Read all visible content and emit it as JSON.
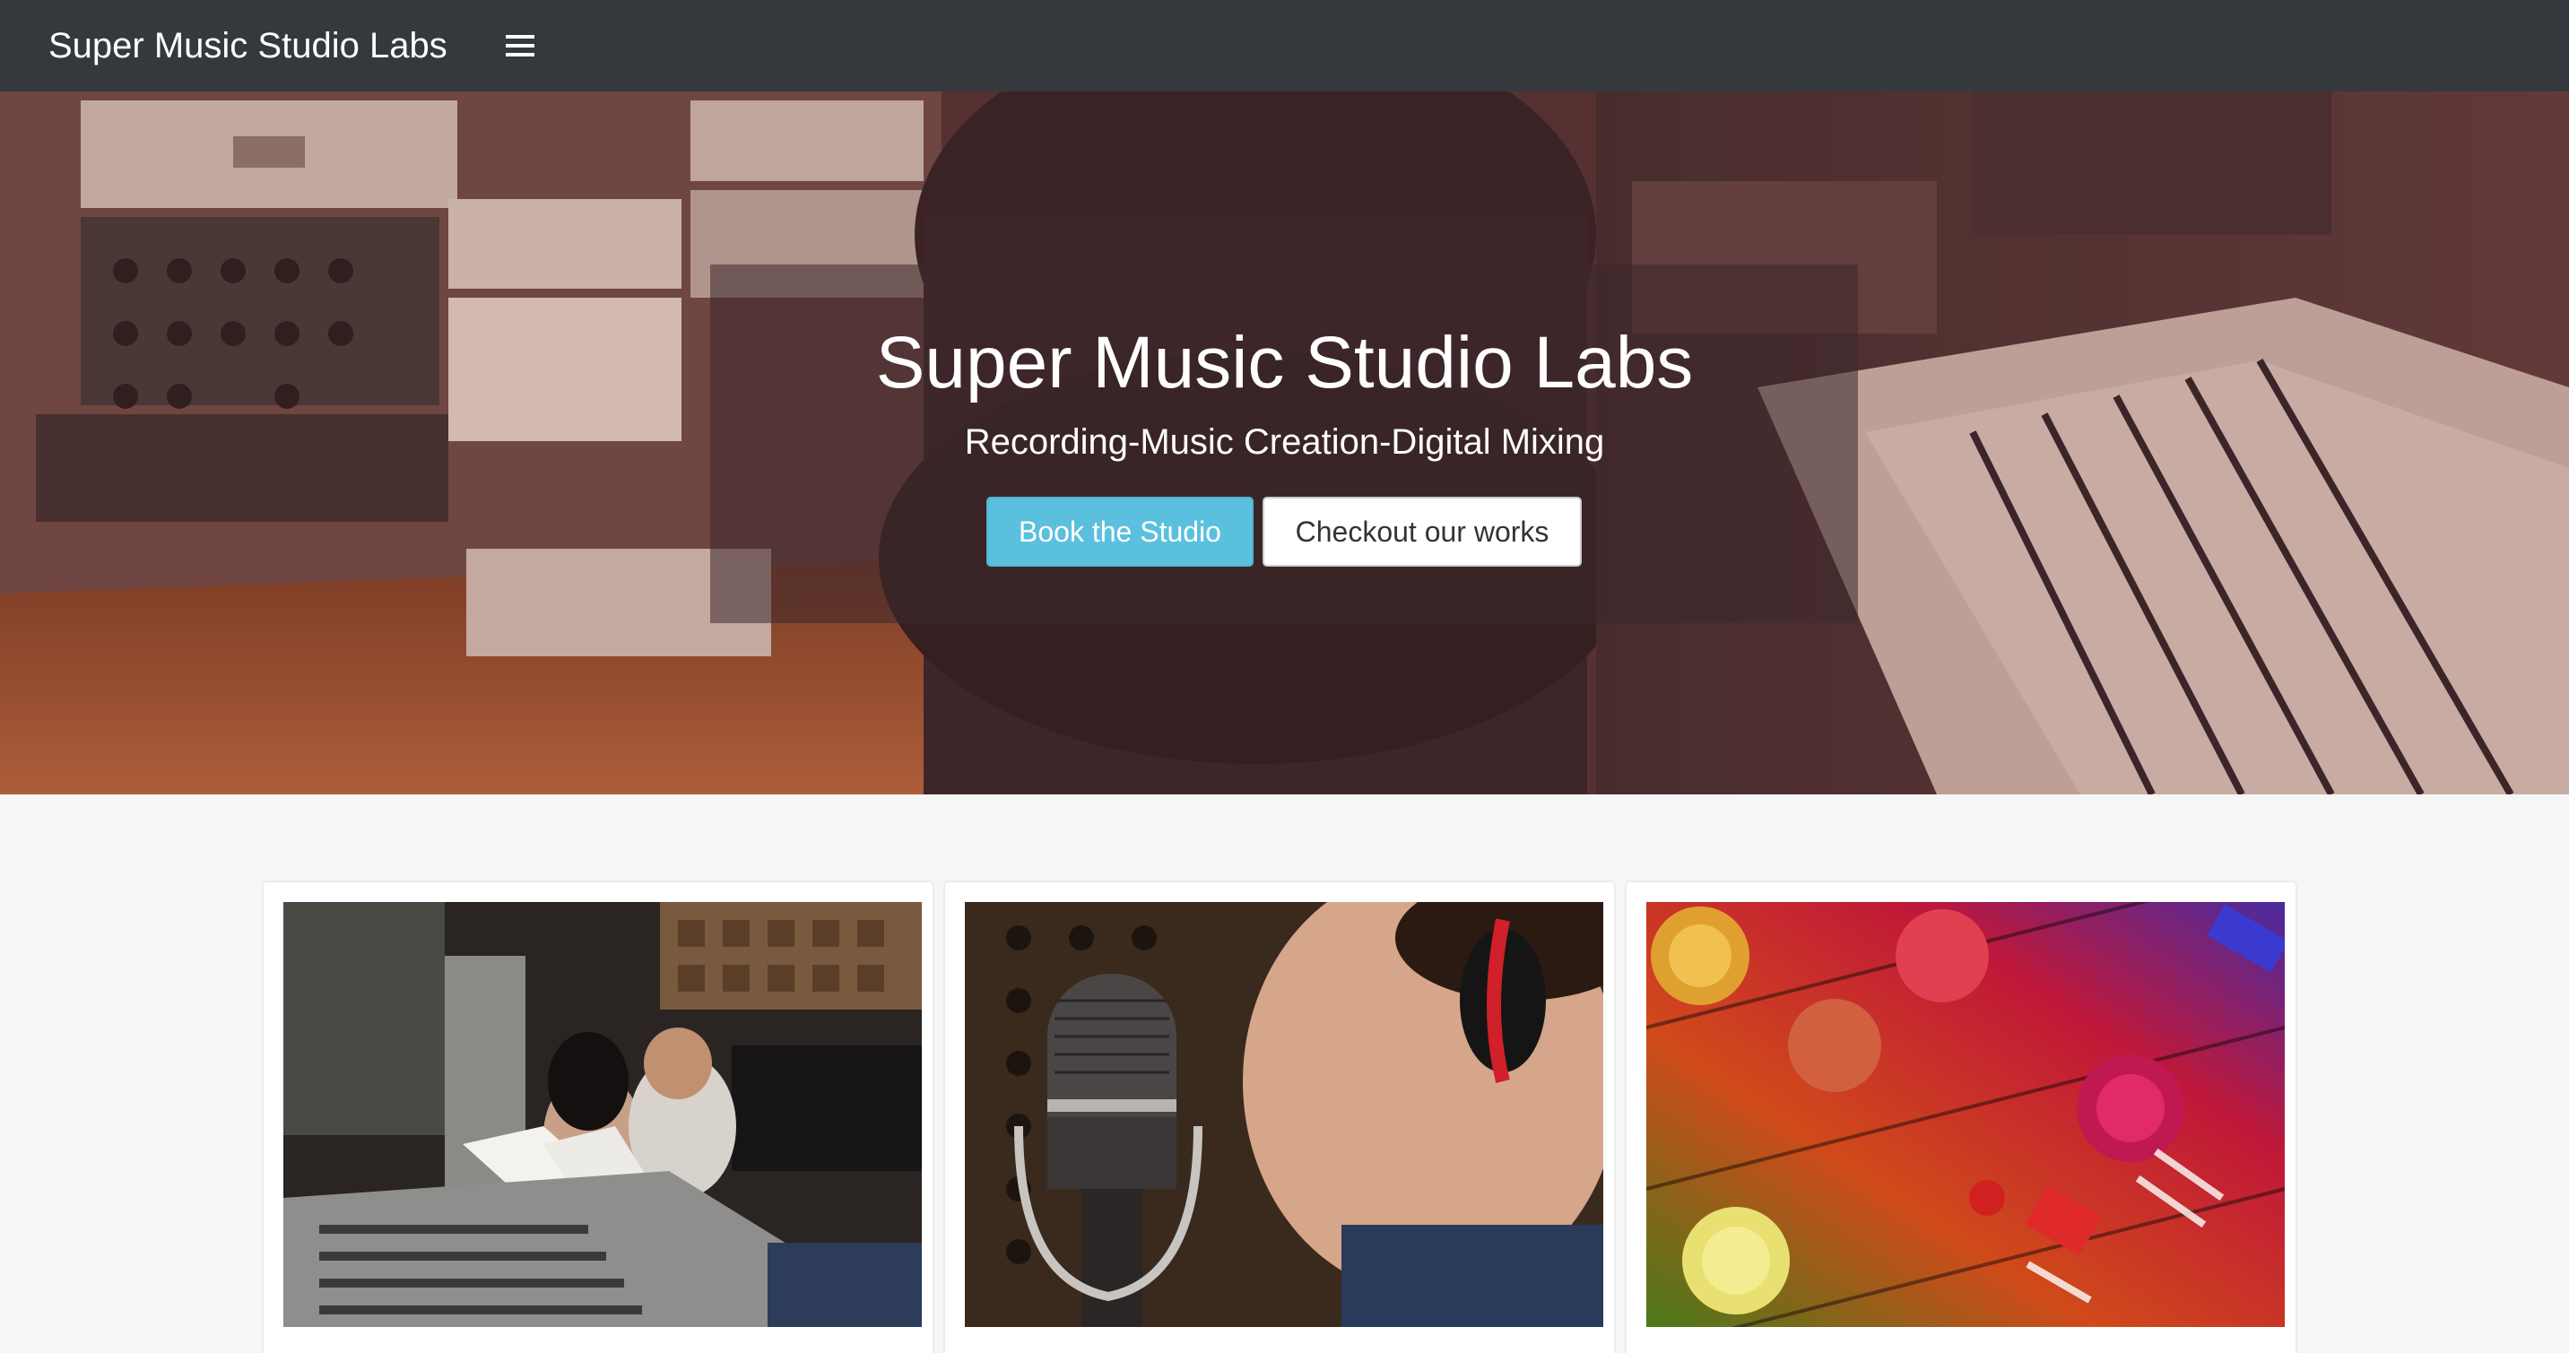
{
  "navbar": {
    "brand": "Super Music Studio Labs",
    "menu_icon": "hamburger-menu-icon"
  },
  "hero": {
    "title": "Super Music Studio Labs",
    "subtitle": "Recording-Music Creation-Digital Mixing",
    "primary_button": "Book the Studio",
    "secondary_button": "Checkout our works",
    "background": "recording-studio-photo"
  },
  "cards": [
    {
      "image": "studio-session-photo"
    },
    {
      "image": "singer-microphone-photo"
    },
    {
      "image": "mixer-knobs-photo"
    }
  ],
  "colors": {
    "navbar": "#35393e",
    "primary_button": "#5bc0de",
    "page_background": "#f6f6f6"
  }
}
